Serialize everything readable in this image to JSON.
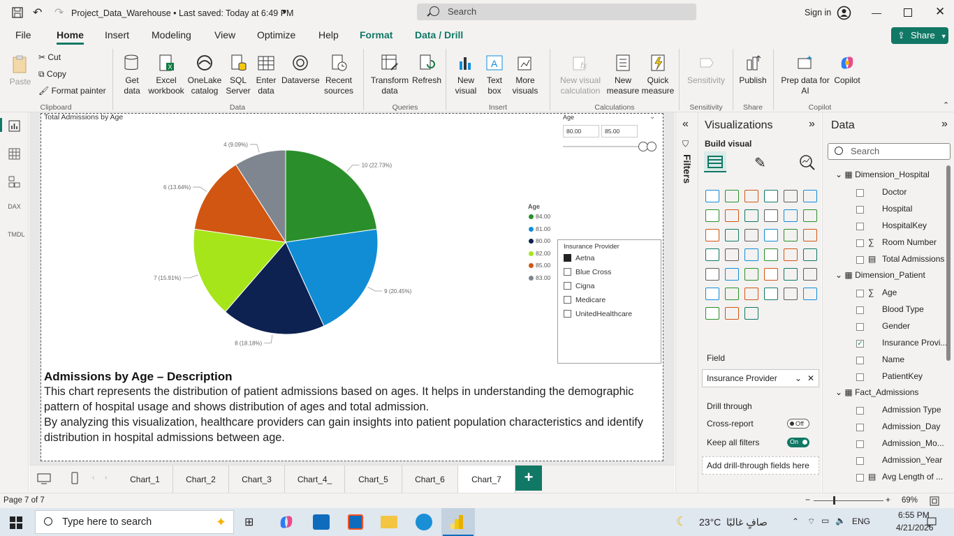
{
  "titlebar": {
    "title": "Project_Data_Warehouse • Last saved: Today at 6:49 PM",
    "search_placeholder": "Search",
    "signin": "Sign in"
  },
  "menu": {
    "items": [
      "File",
      "Home",
      "Insert",
      "Modeling",
      "View",
      "Optimize",
      "Help",
      "Format",
      "Data / Drill"
    ],
    "share": "Share"
  },
  "ribbon": {
    "clipboard": {
      "paste": "Paste",
      "cut": "Cut",
      "copy": "Copy",
      "format_painter": "Format painter",
      "group": "Clipboard"
    },
    "data": {
      "get_data": "Get data",
      "excel": "Excel workbook",
      "onelake": "OneLake catalog",
      "sql": "SQL Server",
      "enter": "Enter data",
      "dataverse": "Dataverse",
      "recent": "Recent sources",
      "group": "Data"
    },
    "queries": {
      "transform": "Transform data",
      "refresh": "Refresh",
      "group": "Queries"
    },
    "insert": {
      "new_visual": "New visual",
      "text_box": "Text box",
      "more_visuals": "More visuals",
      "group": "Insert"
    },
    "calculations": {
      "new_visual_calc": "New visual calculation",
      "new_measure": "New measure",
      "quick_measure": "Quick measure",
      "group": "Calculations"
    },
    "sensitivity": {
      "label": "Sensitivity",
      "group": "Sensitivity"
    },
    "share": {
      "publish": "Publish",
      "group": "Share"
    },
    "copilot": {
      "prep": "Prep data for AI",
      "copilot": "Copilot",
      "group": "Copilot"
    }
  },
  "report": {
    "chart_title": "Total Admissions by Age",
    "slice_labels": [
      "10 (22.73%)",
      "9 (20.45%)",
      "8 (18.18%)",
      "7 (15.91%)",
      "6 (13.64%)",
      "4 (9.09%)"
    ],
    "legend_title": "Age",
    "legend": [
      "84.00",
      "81.00",
      "80.00",
      "82.00",
      "85.00",
      "83.00"
    ],
    "age_filter": {
      "label": "Age",
      "min": "80.00",
      "max": "85.00"
    },
    "slicer": {
      "title": "Insurance Provider",
      "items": [
        "Aetna",
        "Blue Cross",
        "Cigna",
        "Medicare",
        "UnitedHealthcare"
      ]
    },
    "description": {
      "heading": "Admissions by Age – Description",
      "p1": "This chart represents the distribution of patient admissions based on ages. It helps in understanding the demographic pattern of hospital usage and shows distribution of ages and total admission.",
      "p2": "By analyzing this visualization, healthcare providers can gain insights into patient population characteristics and identify distribution in hospital admissions between age."
    }
  },
  "chart_data": {
    "type": "pie",
    "title": "Total Admissions by Age",
    "categories": [
      "84.00",
      "81.00",
      "80.00",
      "82.00",
      "85.00",
      "83.00"
    ],
    "values": [
      10,
      9,
      8,
      7,
      6,
      4
    ],
    "percent": [
      22.73,
      20.45,
      18.18,
      15.91,
      13.64,
      9.09
    ],
    "colors": [
      "#2a8f2a",
      "#118dd6",
      "#0d2251",
      "#a6e51a",
      "#d05612",
      "#7f868f"
    ],
    "legend_position": "right"
  },
  "tabs": [
    "Chart_1",
    "Chart_2",
    "Chart_3",
    "Chart_4_",
    "Chart_5",
    "Chart_6",
    "Chart_7"
  ],
  "filters_label": "Filters",
  "viz": {
    "title": "Visualizations",
    "build": "Build visual",
    "field_label": "Field",
    "field_value": "Insurance Provider",
    "drill": "Drill through",
    "cross_report": "Cross-report",
    "cross_state": "Off",
    "keep_filters": "Keep all filters",
    "keep_state": "On",
    "add_drill": "Add drill-through fields here"
  },
  "data_pane": {
    "title": "Data",
    "search": "Search",
    "tables": [
      {
        "name": "Dimension_Hospital",
        "fields": [
          "Doctor",
          "Hospital",
          "HospitalKey",
          "Room Number",
          "Total Admissions"
        ]
      },
      {
        "name": "Dimension_Patient",
        "fields": [
          "Age",
          "Blood Type",
          "Gender",
          "Insurance Provi...",
          "Name",
          "PatientKey"
        ]
      },
      {
        "name": "Fact_Admissions",
        "fields": [
          "Admission Type",
          "Admission_Day",
          "Admission_Mo...",
          "Admission_Year",
          "Avg Length of ..."
        ]
      }
    ]
  },
  "status": {
    "page": "Page 7 of 7",
    "zoom": "69%"
  },
  "taskbar": {
    "search": "Type here to search",
    "weather": "23°C",
    "weather_text": "صافٍ غالبًا",
    "lang": "ENG",
    "time": "6:55 PM",
    "date": "4/21/2026"
  }
}
